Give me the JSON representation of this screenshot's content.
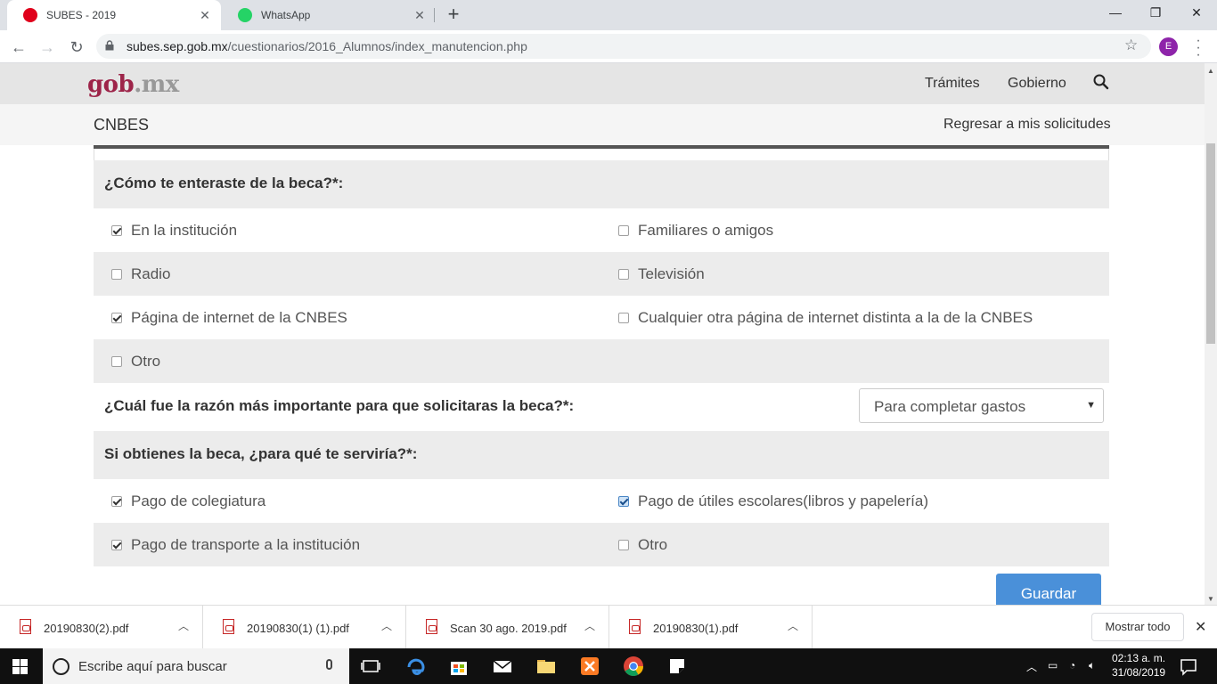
{
  "browser": {
    "tabs": [
      {
        "title": "SUBES - 2019",
        "active": true,
        "favicon_color": "#e0001b"
      },
      {
        "title": "WhatsApp",
        "active": false,
        "favicon_color": "#25d366"
      }
    ],
    "close_glyph": "✕",
    "new_tab_glyph": "+",
    "window_controls": {
      "minimize": "—",
      "maximize": "❐",
      "close": "✕"
    },
    "url_host": "subes.sep.gob.mx",
    "url_path": "/cuestionarios/2016_Alumnos/index_manutencion.php",
    "profile_initial": "E"
  },
  "gob_header": {
    "logo_main": "gob",
    "logo_suffix": ".mx",
    "nav": [
      "Trámites",
      "Gobierno"
    ]
  },
  "subheader": {
    "brand": "CNBES",
    "back_link": "Regresar a mis solicitudes"
  },
  "form": {
    "q1": {
      "title": "¿Cómo te enteraste de la beca?*:",
      "options": [
        {
          "label": "En la institución",
          "checked": true
        },
        {
          "label": "Familiares o amigos",
          "checked": false
        },
        {
          "label": "Radio",
          "checked": false
        },
        {
          "label": "Televisión",
          "checked": false
        },
        {
          "label": "Página de internet de la CNBES",
          "checked": true
        },
        {
          "label": "Cualquier otra página de internet distinta a la de la CNBES",
          "checked": false
        },
        {
          "label": "Otro",
          "checked": false
        }
      ]
    },
    "q2": {
      "title": "¿Cuál fue la razón más importante para que solicitaras la beca?*:",
      "selected": "Para completar gastos"
    },
    "q3": {
      "title": "Si obtienes la beca, ¿para qué te serviría?*:",
      "options": [
        {
          "label": "Pago de colegiatura",
          "checked": true
        },
        {
          "label": "Pago de útiles escolares(libros y papelería)",
          "checked": true
        },
        {
          "label": "Pago de transporte a la institución",
          "checked": true
        },
        {
          "label": "Otro",
          "checked": false
        }
      ]
    },
    "save_label": "Guardar",
    "accent_color": "#4a90d9"
  },
  "downloads": {
    "items": [
      "20190830(2).pdf",
      "20190830(1) (1).pdf",
      "Scan 30 ago. 2019.pdf",
      "20190830(1).pdf"
    ],
    "show_all": "Mostrar todo"
  },
  "taskbar": {
    "search_placeholder": "Escribe aquí para buscar",
    "time": "02:13 a. m.",
    "date": "31/08/2019"
  }
}
